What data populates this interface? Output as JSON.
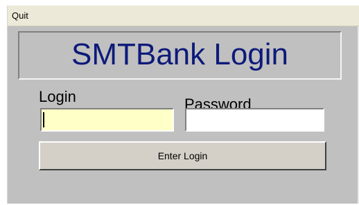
{
  "menubar": {
    "items": [
      {
        "label": "Quit"
      }
    ]
  },
  "title": {
    "text": "SMTBank Login",
    "color": "#0d1a7a"
  },
  "login": {
    "label": "Login",
    "value": "",
    "background": "#ffffc8"
  },
  "password": {
    "label": "Password",
    "value": ""
  },
  "enter_button": {
    "label": "Enter Login"
  },
  "colors": {
    "window_background": "#c0c0c0",
    "menubar_background": "#ece9d8"
  }
}
